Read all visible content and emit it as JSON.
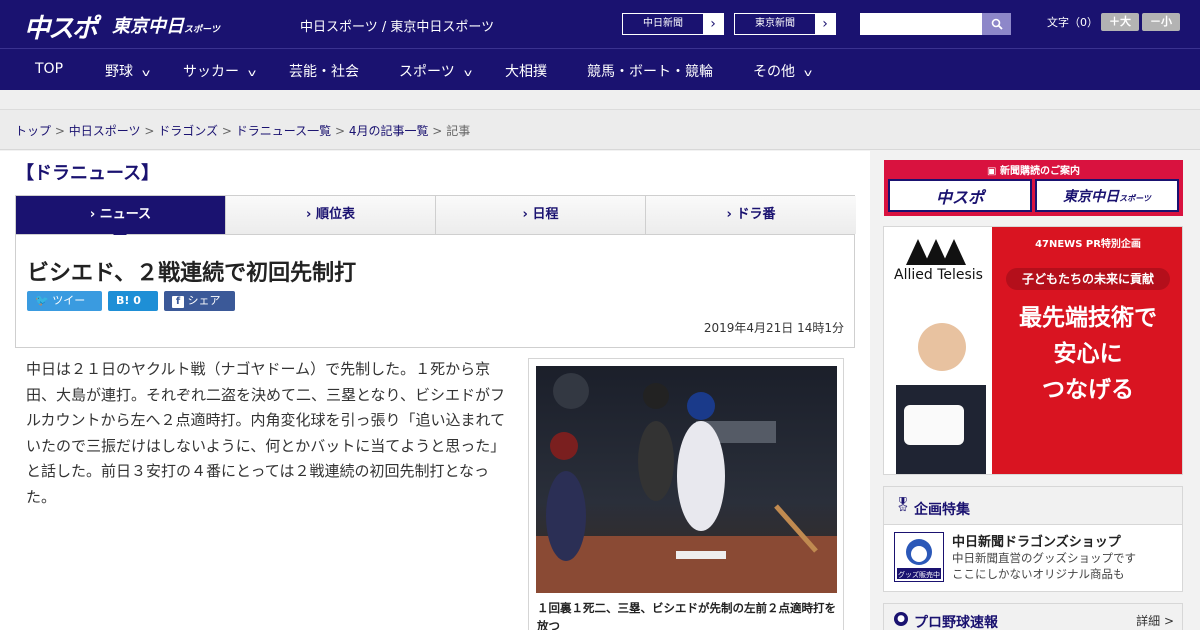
{
  "header": {
    "logo_chuspo": "中スポ",
    "logo_tokyo": "東京中日",
    "logo_tokyo_sub": "スポーツ",
    "site_title": "中日スポーツ / 東京中日スポーツ",
    "link_chunichi": "中日新聞",
    "link_tokyo": "東京新聞",
    "search_placeholder": "",
    "font_label": "文字（0）",
    "font_larger": "＋大",
    "font_smaller": "－小"
  },
  "nav": {
    "items": [
      {
        "label": "TOP"
      },
      {
        "label": "野球"
      },
      {
        "label": "サッカー"
      },
      {
        "label": "芸能・社会"
      },
      {
        "label": "スポーツ"
      },
      {
        "label": "大相撲"
      },
      {
        "label": "競馬・ボート・競輪"
      },
      {
        "label": "その他"
      }
    ]
  },
  "breadcrumb": {
    "items": [
      "トップ",
      "中日スポーツ",
      "ドラゴンズ",
      "ドラニュース一覧",
      "4月の記事一覧"
    ],
    "current": "記事",
    "separator": ">"
  },
  "section_title": "【ドラニュース】",
  "tabs": [
    {
      "label": "ニュース"
    },
    {
      "label": "順位表"
    },
    {
      "label": "日程"
    },
    {
      "label": "ドラ番"
    }
  ],
  "article": {
    "headline": "ビシエド、２戦連続で初回先制打",
    "share_tweet": "ツイート",
    "share_hatena": "B! 0",
    "share_facebook": "シェア 0",
    "date": "2019年4月21日 14時1分",
    "body": "中日は２１日のヤクルト戦（ナゴヤドーム）で先制した。１死から京田、大島が連打。それぞれ二盗を決めて二、三塁となり、ビシエドがフルカウントから左へ２点適時打。内角変化球を引っ張り「追い込まれていたので三振だけはしないように、何とかバットに当てようと思った」と話した。前日３安打の４番にとっては２戦連続の初回先制打となった。",
    "caption": "１回裏１死二、三塁、ビシエドが先制の左前２点適時打を放つ"
  },
  "sidebar": {
    "subscription_title": "新聞購読のご案内",
    "sub_chuspo": "中スポ",
    "sub_tokyo": "東京中日",
    "sub_tokyo_small": "スポーツ",
    "ad_brand": "Allied Telesis",
    "ad_top": "47NEWS PR特別企画",
    "ad_pill": "子どもたちの未来に貢献",
    "ad_line1": "最先端技術で",
    "ad_line2": "安心に",
    "ad_line3": "つなげる",
    "feature_title": "企画特集",
    "feature_name": "中日新聞ドラゴンズショップ",
    "feature_desc1": "中日新聞直営のグッズショップです",
    "feature_desc2": "ここにしかないオリジナル商品も",
    "feature_thumb_label": "グッズ販売中",
    "baseball_title": "プロ野球速報",
    "baseball_more": "詳細 >"
  }
}
